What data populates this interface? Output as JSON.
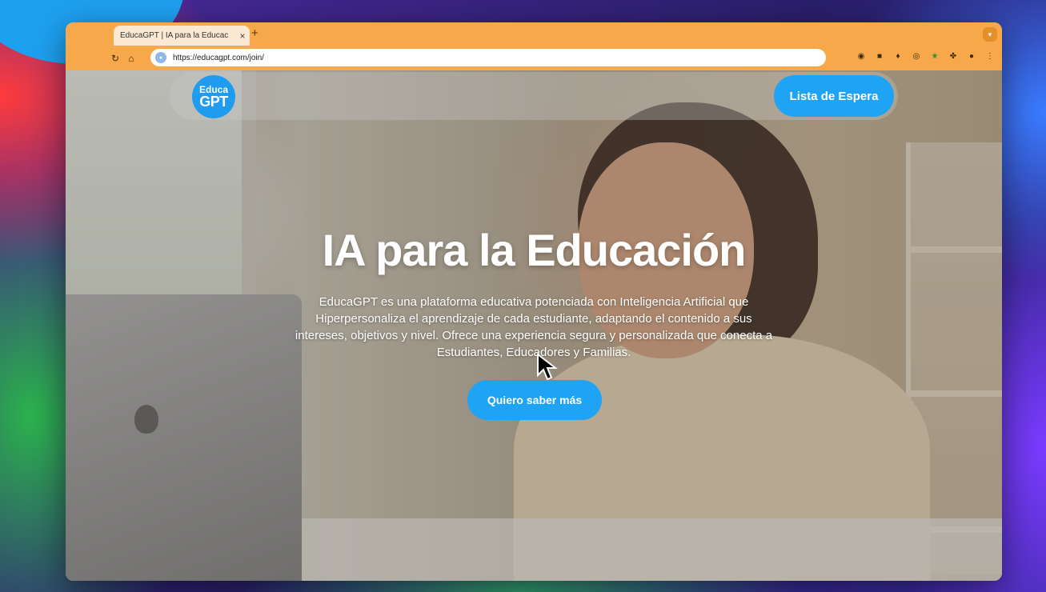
{
  "browser": {
    "tab_title": "EducaGPT | IA para la Educac",
    "tab_close": "×",
    "new_tab": "+",
    "url": "https://educagpt.com/join/",
    "accent_color": "#f6a84a"
  },
  "site": {
    "logo_line1": "Educa",
    "logo_line2": "GPT",
    "waitlist_label": "Lista de Espera",
    "brand_color": "#1fa3f5"
  },
  "hero": {
    "title": "IA para la Educación",
    "description": "EducaGPT es una plataforma educativa potenciada con Inteligencia Artificial que Hiperpersonaliza el aprendizaje de cada estudiante, adaptando el contenido a sus intereses, objetivos y nivel. Ofrece una experiencia segura y personalizada que conecta a Estudiantes, Educadores y Familias.",
    "cta_label": "Quiero saber más"
  }
}
